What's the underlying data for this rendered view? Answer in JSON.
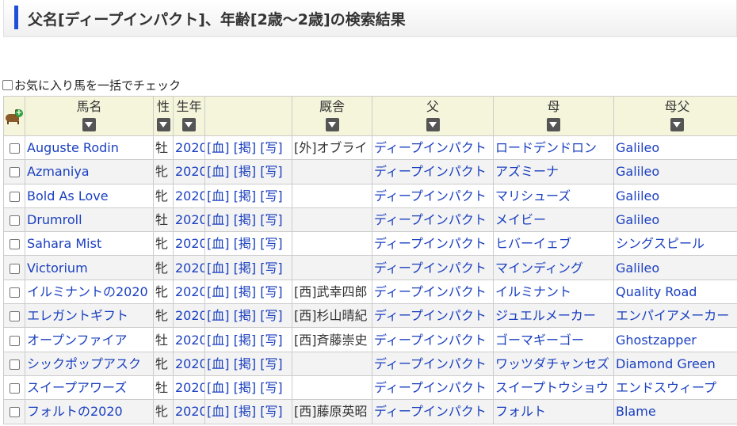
{
  "page": {
    "title": "父名[ディープインパクト]、年齢[2歳～2歳]の検索結果",
    "check_all_label": "お気に入り馬を一括でチェック"
  },
  "table": {
    "headers": {
      "name": "馬名",
      "sex": "性",
      "year": "生年",
      "links": "",
      "stable": "厩舎",
      "sire": "父",
      "dam": "母",
      "damsire": "母父"
    },
    "rows": [
      {
        "name": "Auguste Rodin",
        "sex": "牡",
        "year": "2020",
        "blood": "[血]",
        "post": "[掲]",
        "photo": "[写]",
        "stable": "[外]オブライ",
        "sire": "ディープインパクト",
        "dam": "ロードデンドロン",
        "damsire": "Galileo"
      },
      {
        "name": "Azmaniya",
        "sex": "牝",
        "year": "2020",
        "blood": "[血]",
        "post": "[掲]",
        "photo": "[写]",
        "stable": "",
        "sire": "ディープインパクト",
        "dam": "アズミーナ",
        "damsire": "Galileo"
      },
      {
        "name": "Bold As Love",
        "sex": "牝",
        "year": "2020",
        "blood": "[血]",
        "post": "[掲]",
        "photo": "[写]",
        "stable": "",
        "sire": "ディープインパクト",
        "dam": "マリシューズ",
        "damsire": "Galileo"
      },
      {
        "name": "Drumroll",
        "sex": "牡",
        "year": "2020",
        "blood": "[血]",
        "post": "[掲]",
        "photo": "[写]",
        "stable": "",
        "sire": "ディープインパクト",
        "dam": "メイビー",
        "damsire": "Galileo"
      },
      {
        "name": "Sahara Mist",
        "sex": "牝",
        "year": "2020",
        "blood": "[血]",
        "post": "[掲]",
        "photo": "[写]",
        "stable": "",
        "sire": "ディープインパクト",
        "dam": "ヒバーイェブ",
        "damsire": "シングスピール"
      },
      {
        "name": "Victorium",
        "sex": "牝",
        "year": "2020",
        "blood": "[血]",
        "post": "[掲]",
        "photo": "[写]",
        "stable": "",
        "sire": "ディープインパクト",
        "dam": "マインディング",
        "damsire": "Galileo"
      },
      {
        "name": "イルミナントの2020",
        "sex": "牝",
        "year": "2020",
        "blood": "[血]",
        "post": "[掲]",
        "photo": "[写]",
        "stable": "[西]武幸四郎",
        "sire": "ディープインパクト",
        "dam": "イルミナント",
        "damsire": "Quality Road"
      },
      {
        "name": "エレガントギフト",
        "sex": "牝",
        "year": "2020",
        "blood": "[血]",
        "post": "[掲]",
        "photo": "[写]",
        "stable": "[西]杉山晴紀",
        "sire": "ディープインパクト",
        "dam": "ジュエルメーカー",
        "damsire": "エンパイアメーカー"
      },
      {
        "name": "オープンファイア",
        "sex": "牡",
        "year": "2020",
        "blood": "[血]",
        "post": "[掲]",
        "photo": "[写]",
        "stable": "[西]斉藤崇史",
        "sire": "ディープインパクト",
        "dam": "ゴーマギーゴー",
        "damsire": "Ghostzapper"
      },
      {
        "name": "シックポップアスク",
        "sex": "牝",
        "year": "2020",
        "blood": "[血]",
        "post": "[掲]",
        "photo": "[写]",
        "stable": "",
        "sire": "ディープインパクト",
        "dam": "ワッツダチャンセズ",
        "damsire": "Diamond Green"
      },
      {
        "name": "スイープアワーズ",
        "sex": "牡",
        "year": "2020",
        "blood": "[血]",
        "post": "[掲]",
        "photo": "[写]",
        "stable": "",
        "sire": "ディープインパクト",
        "dam": "スイープトウショウ",
        "damsire": "エンドスウィープ"
      },
      {
        "name": "フォルトの2020",
        "sex": "牝",
        "year": "2020",
        "blood": "[血]",
        "post": "[掲]",
        "photo": "[写]",
        "stable": "[西]藤原英昭",
        "sire": "ディープインパクト",
        "dam": "フォルト",
        "damsire": "Blame"
      }
    ]
  },
  "colors": {
    "accent": "#1f4fd6",
    "link": "#1a3fbf",
    "header_bg": "#f5f5dc",
    "stripe_bg": "#f3f3f3"
  },
  "icons": {
    "favorite_add": "horse-plus-icon",
    "sort": "sort-down-icon"
  }
}
